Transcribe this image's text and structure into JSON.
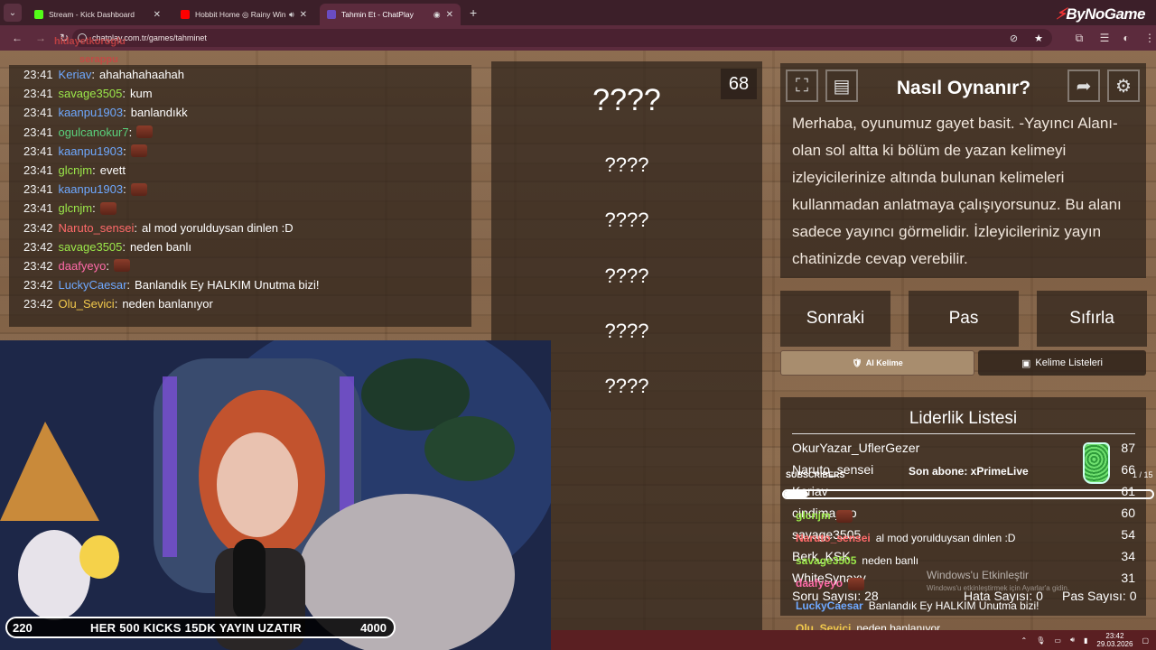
{
  "browser": {
    "tabs": [
      {
        "title": "Stream - Kick Dashboard",
        "favicon_color": "#53fc18",
        "active": false
      },
      {
        "title": "Hobbit Home ◎ Rainy Win",
        "favicon_color": "#ff0000",
        "active": false
      },
      {
        "title": "Tahmin Et - ChatPlay",
        "favicon_color": "#6a4cc2",
        "active": true
      }
    ],
    "url": "chatplay.com.tr/games/tahminet",
    "brand": "ByNoGame"
  },
  "chat": {
    "messages": [
      {
        "time": "23:41",
        "user": "Keriav",
        "color": "#6ea8ff",
        "msg": "ahahahahaahah",
        "emote": false
      },
      {
        "time": "23:41",
        "user": "savage3505",
        "color": "#9be84a",
        "msg": "kum",
        "emote": false
      },
      {
        "time": "23:41",
        "user": "kaanpu1903",
        "color": "#6ea8ff",
        "msg": "banlandıkk",
        "emote": false
      },
      {
        "time": "23:41",
        "user": "ogulcanokur7",
        "color": "#5ad17c",
        "msg": "",
        "emote": true
      },
      {
        "time": "23:41",
        "user": "kaanpu1903",
        "color": "#6ea8ff",
        "msg": "",
        "emote": true
      },
      {
        "time": "23:41",
        "user": "glcnjm",
        "color": "#9be84a",
        "msg": "evett",
        "emote": false
      },
      {
        "time": "23:41",
        "user": "kaanpu1903",
        "color": "#6ea8ff",
        "msg": "",
        "emote": true
      },
      {
        "time": "23:41",
        "user": "glcnjm",
        "color": "#9be84a",
        "msg": "",
        "emote": true
      },
      {
        "time": "23:42",
        "user": "Naruto_sensei",
        "color": "#ff6a6a",
        "msg": "al mod yorulduysan dinlen :D",
        "emote": false
      },
      {
        "time": "23:42",
        "user": "savage3505",
        "color": "#9be84a",
        "msg": "neden banlı",
        "emote": false
      },
      {
        "time": "23:42",
        "user": "daafyeyo",
        "color": "#ff6aa8",
        "msg": "",
        "emote": true
      },
      {
        "time": "23:42",
        "user": "LuckyCaesar",
        "color": "#6ea8ff",
        "msg": "Banlandık Ey HALKIM Unutma bizi!",
        "emote": false
      },
      {
        "time": "23:42",
        "user": "Olu_Sevici",
        "color": "#f2c94c",
        "msg": "neden banlanıyor",
        "emote": false
      }
    ]
  },
  "game": {
    "timer": "68",
    "clues": [
      "????",
      "????",
      "????",
      "????",
      "????",
      "????"
    ],
    "howto_title": "Nasıl Oynanır?",
    "howto_text": "Merhaba, oyunumuz gayet basit. -Yayıncı Alanı- olan sol altta ki bölüm de yazan kelimeyi izleyicilerinize altında bulunan kelimeleri kullanmadan anlatmaya çalışıyorsunuz. Bu alanı sadece yayıncı görmelidir. İzleyicileriniz yayın chatinizde cevap verebilir.",
    "buttons": {
      "next": "Sonraki",
      "pass": "Pas",
      "reset": "Sıfırla"
    },
    "ai_word": "AI Kelime",
    "word_lists": "Kelime Listeleri",
    "leaderboard_title": "Liderlik Listesi",
    "leaderboard": [
      {
        "name": "OkurYazar_UflerGezer",
        "score": "87"
      },
      {
        "name": "Naruto_sensei",
        "score": "66"
      },
      {
        "name": "Keriav",
        "score": "61"
      },
      {
        "name": "cindima__o",
        "score": "60"
      },
      {
        "name": "savage3505",
        "score": "54"
      },
      {
        "name": "Berk_KSK",
        "score": "34"
      },
      {
        "name": "WhiteSynaxy",
        "score": "31"
      }
    ],
    "soru": "Soru Sayısı: 28",
    "hata": "Hata Sayısı: 0",
    "pas": "Pas Sayısı: 0"
  },
  "overlay": {
    "top_names": [
      "hidayetkoroglu",
      "serappu"
    ],
    "subs_label": "SUBSCRIBERS",
    "last_sub": "Son abone: xPrimeLive",
    "sub_count": "1 / 15",
    "sub_progress": 0.067,
    "chat": [
      {
        "user": "glcnjm",
        "color": "#9be84a",
        "msg": ""
      },
      {
        "user": "Naruto_sensei",
        "color": "#ff6a6a",
        "msg": "al mod yorulduysan dinlen :D"
      },
      {
        "user": "savage3505",
        "color": "#9be84a",
        "msg": "neden banlı"
      },
      {
        "user": "daafyeyo",
        "color": "#ff6aa8",
        "msg": ""
      },
      {
        "user": "LuckyCaesar",
        "color": "#6ea8ff",
        "msg": "Banlandık Ey HALKIM Unutma bizi!"
      },
      {
        "user": "Olu_Sevici",
        "color": "#f2c94c",
        "msg": "neden banlanıyor"
      }
    ],
    "ticker_left": "220",
    "ticker_text": "HER 500 KICKS 15DK YAYIN UZATIR",
    "ticker_right": "4000",
    "win_activate": "Windows'u Etkinleştir",
    "win_activate_sub": "Windows'u etkinleştirmek için Ayarlar'a gidin."
  },
  "taskbar": {
    "time": "23:42",
    "date": "29.03.2026"
  }
}
